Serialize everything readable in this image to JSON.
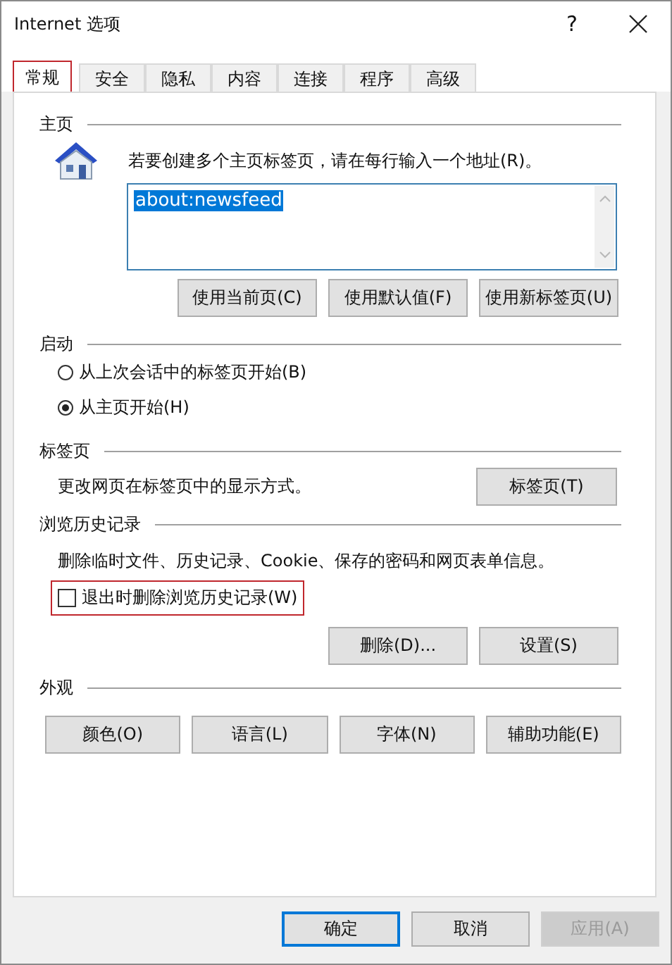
{
  "window": {
    "title": "Internet 选项",
    "help": "?"
  },
  "tabs": [
    {
      "label": "常规",
      "selected": true,
      "highlighted": true
    },
    {
      "label": "安全",
      "selected": false,
      "highlighted": false
    },
    {
      "label": "隐私",
      "selected": false,
      "highlighted": false
    },
    {
      "label": "内容",
      "selected": false,
      "highlighted": false
    },
    {
      "label": "连接",
      "selected": false,
      "highlighted": false
    },
    {
      "label": "程序",
      "selected": false,
      "highlighted": false
    },
    {
      "label": "高级",
      "selected": false,
      "highlighted": false
    }
  ],
  "home": {
    "heading": "主页",
    "instruction": "若要创建多个主页标签页，请在每行输入一个地址(R)。",
    "addresses": "about:newsfeed",
    "text_selected": true,
    "buttons": [
      "使用当前页(C)",
      "使用默认值(F)",
      "使用新标签页(U)"
    ]
  },
  "startup": {
    "heading": "启动",
    "options": [
      {
        "label": "从上次会话中的标签页开始(B)",
        "selected": false
      },
      {
        "label": "从主页开始(H)",
        "selected": true
      }
    ]
  },
  "tab_settings": {
    "heading": "标签页",
    "description": "更改网页在标签页中的显示方式。",
    "button": "标签页(T)"
  },
  "history": {
    "heading": "浏览历史记录",
    "description": "删除临时文件、历史记录、Cookie、保存的密码和网页表单信息。",
    "delete_on_exit": {
      "label": "退出时删除浏览历史记录(W)",
      "checked": false,
      "highlighted": true
    },
    "buttons": [
      "删除(D)...",
      "设置(S)"
    ]
  },
  "appearance": {
    "heading": "外观",
    "buttons": [
      "颜色(O)",
      "语言(L)",
      "字体(N)",
      "辅助功能(E)"
    ]
  },
  "footer_buttons": [
    {
      "label": "确定",
      "default": true,
      "disabled": false
    },
    {
      "label": "取消",
      "default": false,
      "disabled": false
    },
    {
      "label": "应用(A)",
      "default": false,
      "disabled": true
    }
  ]
}
